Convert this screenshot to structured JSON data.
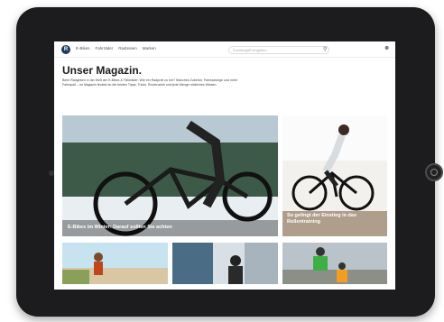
{
  "header": {
    "logo_letter": "R",
    "nav": [
      "E-Bikes",
      "Fahrräder",
      "Radreisen",
      "Marken"
    ],
    "search_placeholder": "Suchbegriff eingeben"
  },
  "main": {
    "title": "Unser Magazin.",
    "intro": "Beim Radgeben in der Welt der E-Bikes & Fahrräder: Wie ein Radprofi zu mir? Manches Zubehör, Fahrradwege und mehr Fahrspaß – im Magazin findest du die besten Tipps, Tricks, Routenziele und jede Menge nützliches Wissen."
  },
  "articles": [
    {
      "caption": "E-Bikes im Winter: Darauf sollten Sie achten"
    },
    {
      "caption": "So gelingt der Einstieg in das Rollentraining"
    },
    {
      "caption": ""
    },
    {
      "caption": ""
    },
    {
      "caption": ""
    }
  ]
}
